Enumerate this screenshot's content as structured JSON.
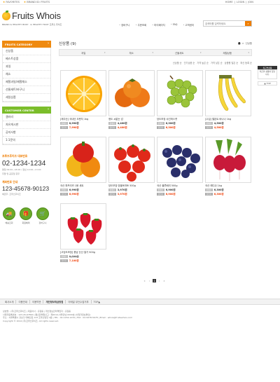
{
  "topbar": {
    "left": [
      "FAVORITES",
      "BRAND ID: FRUITS"
    ],
    "right": [
      "HOME",
      "LOGIN",
      "JOIN"
    ]
  },
  "brand": {
    "name": "Fruits Whois",
    "tagline": "BRAND & HEALTHY BODY · & HEALTHY FRUIT  프루츠 후이즈"
  },
  "mainnav": [
    "장바구니",
    "주문조회",
    "마이페이지",
    "FAQ",
    "고객센터"
  ],
  "search": {
    "placeholder": "검색어를 입력하세요."
  },
  "sidebar": {
    "category_title": "FRUITS CATEGORY",
    "categories": [
      "신상품",
      "베스트상품",
      "과일",
      "채소",
      "제철과일/제철채소",
      "선물세트/바구니",
      "세일상품"
    ],
    "customer_title": "CUSTOMER CENTER",
    "customer": [
      "갤러리",
      "자유게시판",
      "공지사항",
      "1:1문의"
    ]
  },
  "callcenter": {
    "title": "프루츠후이즈 대표번호",
    "phone": "02-1234-1234",
    "note1": "평일 09:00~18:00 / 점심 12:00~13:00",
    "note2": "주말 및 공휴일 휴무",
    "title2": "계좌번호 안내",
    "phone2": "123-45678-90123",
    "note3": "예금주: 프루츠후이즈",
    "circles": [
      {
        "label": "배송조회",
        "icon": "truck-icon"
      },
      {
        "label": "회원혜택",
        "icon": "gift-icon"
      },
      {
        "label": "장바구니",
        "icon": "cart-icon"
      }
    ]
  },
  "content": {
    "title": "신상품 (9)",
    "breadcrumb": [
      "HOME",
      "신상품"
    ],
    "filters": [
      "과일",
      "채소",
      "선물세트",
      "제철상품"
    ],
    "sorts": [
      "신상품 순",
      "인기상품 순",
      "가격 높은 순",
      "가격 낮은 순",
      "상품평 많은 순",
      "최신 등록 순"
    ]
  },
  "products": [
    {
      "name": "[제주산] 국내산 오렌지 1kg",
      "price_label": "판매가",
      "price": "8,990원",
      "sale_label": "할인가",
      "sale": "7,990원",
      "type": "orange"
    },
    {
      "name": "청도 씨없는 감",
      "price_label": "판매가",
      "price": "4,400원",
      "sale_label": "할인가",
      "sale": "4,400원",
      "type": "persimmon"
    },
    {
      "name": "당도보장 샤인머스캣",
      "price_label": "판매가",
      "price": "6,300원",
      "sale_label": "할인가",
      "sale": "6,300원",
      "type": "grape"
    },
    {
      "name": "[수입] 델몬트 바나나 1kg",
      "price_label": "판매가",
      "price": "4,500원",
      "sale_label": "할인가",
      "sale": "4,500원",
      "type": "banana"
    },
    {
      "name": "국산 파프리카 1봉 세트",
      "price_label": "판매가",
      "price": "6,990원",
      "sale_label": "할인가",
      "sale": "6,990원",
      "type": "pepper"
    },
    {
      "name": "당도보장 방울토마토 500g",
      "price_label": "판매가",
      "price": "3,970원",
      "sale_label": "할인가",
      "sale": "3,970원",
      "type": "tomato"
    },
    {
      "name": "국산 블루베리 500g",
      "price_label": "판매가",
      "price": "6,900원",
      "sale_label": "할인가",
      "sale": "6,900원",
      "type": "blueberry"
    },
    {
      "name": "국산 래디쉬 1kg",
      "price_label": "판매가",
      "price": "6,300원",
      "sale_label": "할인가",
      "sale": "6,300원",
      "type": "radish"
    },
    {
      "name": "[고당도보장] 충남 논산 딸기 500g",
      "price_label": "판매가",
      "price": "8,700원",
      "price_strike": true,
      "sale_label": "할인가",
      "sale": "7,100원",
      "type": "strawberry"
    }
  ],
  "pager": {
    "prev2": "«",
    "prev": "‹",
    "current": "1",
    "next": "›",
    "next2": "»"
  },
  "footer": {
    "links": [
      "회사소개",
      "이용안내",
      "이용약관",
      "개인정보취급방침",
      "이메일 무단수집거부",
      "TOP▲"
    ],
    "emph_index": 3,
    "lines": [
      "상호명 : (주)프루츠후이즈 | 대표이사 : 홍길동 | 개인정보관리책임자 : 홍길동",
      "사업자등록번호 : 123-45-67890 | 통신판매업신고 : 제2014-서울강남-0000호 [사업자정보확인]",
      "주소 : 서울특별시 강남구 테헤란로 123 프루츠빌딩 4층 | TEL : 02-1234-1234 | FAX : 02-5678-5678 | Email : whois@fruitswhois.com",
      "Copyright © 2014 (주)프루츠후이즈. All rights reserved."
    ]
  },
  "rightbox": {
    "head": "최근본상품",
    "body": "최근본 상품이 없습니다.",
    "top": "TOP"
  }
}
